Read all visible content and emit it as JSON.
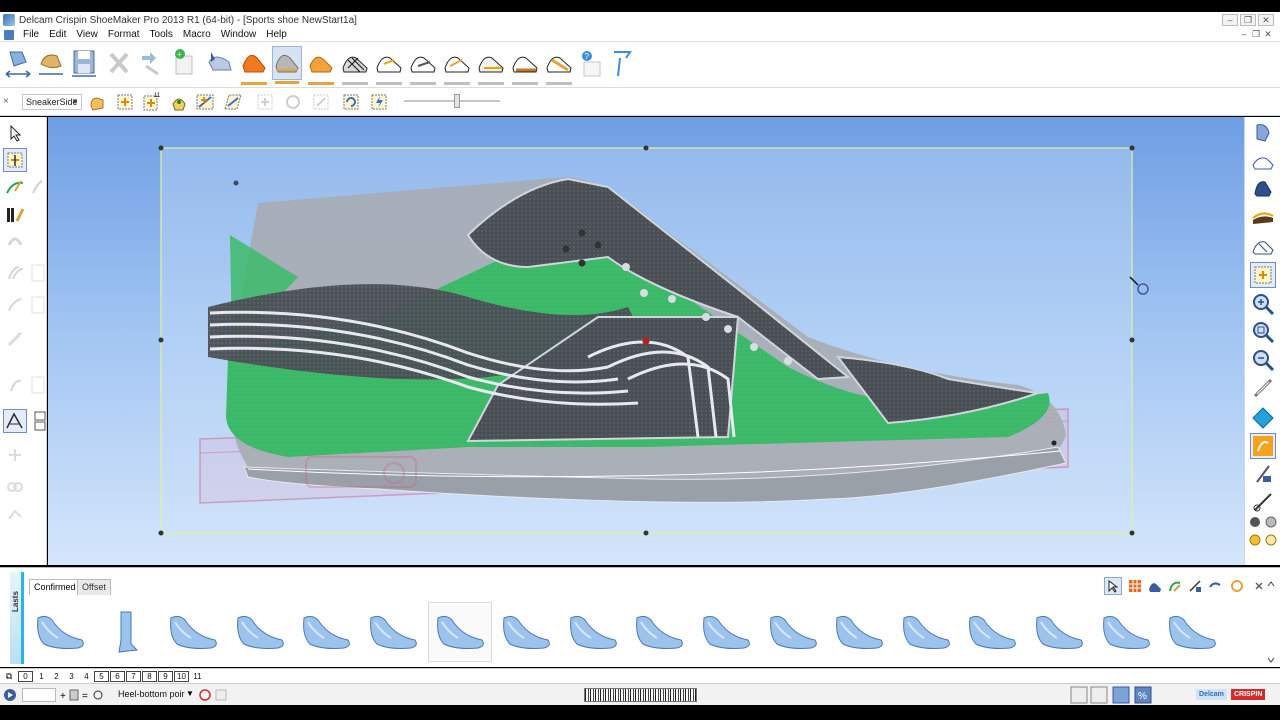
{
  "window": {
    "title": "Delcam Crispin ShoeMaker Pro 2013 R1 (64-bit) - [Sports shoe NewStart1a]",
    "controls": [
      "‒",
      "❐",
      "✕"
    ],
    "mdi_controls": [
      "‒",
      "❐",
      "✕"
    ]
  },
  "menu": {
    "items": [
      "File",
      "Edit",
      "View",
      "Format",
      "Tools",
      "Macro",
      "Window",
      "Help"
    ]
  },
  "toolbar1": {
    "icons": [
      "last-arrows-icon",
      "last-tools-icon",
      "save-icon",
      "delete-icon",
      "undo-icon",
      "new-icon",
      "pointer-shoe-icon",
      "shoe-orange-icon",
      "shoe-grey-icon",
      "shoe-orange2-icon",
      "sneaker-hatched-icon",
      "sneaker-1-icon",
      "sneaker-2-icon",
      "sneaker-3-icon",
      "sneaker-4-icon",
      "sneaker-5-icon",
      "sneaker-6-icon",
      "help-icon",
      "paper-icon",
      "flag-icon"
    ]
  },
  "toolbar2": {
    "view_combo": "SneakerSide",
    "icons": [
      "hand-tool-icon",
      "fit-view-icon",
      "numbered-view-icon",
      "rotate-shoe-icon",
      "grid-transform-icon",
      "warp-icon",
      "move-disabled-icon",
      "rotate-disabled-icon",
      "scale-disabled-icon",
      "refresh-icon",
      "bolt-icon"
    ],
    "zoom_slider": 0.55
  },
  "panel": {
    "vertical_tab": "Lasts",
    "tabs": [
      "Confirmed",
      "Offset"
    ],
    "active_tab": "Confirmed",
    "last_count": 18,
    "selected_index": 6
  },
  "pages": {
    "plain": [
      "1",
      "2",
      "3",
      "4"
    ],
    "boxed": [
      "5",
      "6",
      "7",
      "8",
      "9",
      "10"
    ],
    "tail": [
      "11"
    ],
    "first": "0"
  },
  "status": {
    "heel_combo": "Heel-bottom poir",
    "brand_left": "Delcam",
    "brand_right": "CRISPIN"
  },
  "colors": {
    "accent_green": "#3dbb6a",
    "dark_panel": "#4a4d52",
    "canvas_top": "#6e9ee4",
    "canvas_bottom": "#d5e6fb",
    "selection": "#e1f29a",
    "crispin_red": "#d32b2b"
  }
}
